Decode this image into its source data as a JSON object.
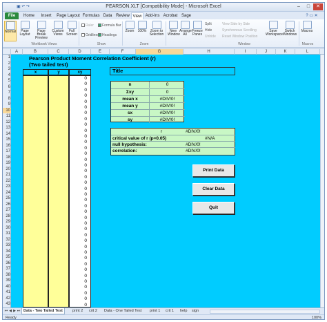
{
  "window": {
    "title": "PEARSON.XLT  [Compatibility Mode] - Microsoft Excel",
    "minimize": "–",
    "maximize": "□",
    "close": "✕"
  },
  "ribbon_tabs": [
    "File",
    "Home",
    "Insert",
    "Page Layout",
    "Formulas",
    "Data",
    "Review",
    "View",
    "Add-Ins",
    "Acrobat",
    "Sage"
  ],
  "ribbon": {
    "normal": "Normal",
    "page_layout": "Page Layout",
    "page_break_preview": "Page Break Preview",
    "custom_views": "Custom Views",
    "full_screen": "Full Screen",
    "ruler": "Ruler",
    "gridlines": "Gridlines",
    "formula_bar": "Formula Bar",
    "headings": "Headings",
    "zoom": "Zoom",
    "zoom_100": "100%",
    "zoom_to_selection": "Zoom to Selection",
    "new_window": "New Window",
    "arrange_all": "Arrange All",
    "freeze_panes": "Freeze Panes",
    "split": "Split",
    "hide": "Hide",
    "unhide": "Unhide",
    "view_side_by_side": "View Side by Side",
    "synchronous_scrolling": "Synchronous Scrolling",
    "reset_window_position": "Reset Window Position",
    "save_workspace": "Save Workspace",
    "switch_windows": "Switch Windows",
    "macros": "Macros",
    "group_workbook_views": "Workbook Views",
    "group_show": "Show",
    "group_zoom": "Zoom",
    "group_window": "Window",
    "group_macros": "Macros"
  },
  "columns": [
    "A",
    "B",
    "C",
    "D",
    "E",
    "F",
    "G",
    "H",
    "I",
    "J",
    "K",
    "L"
  ],
  "rows": [
    "1",
    "2",
    "3",
    "4",
    "5",
    "6",
    "7",
    "8",
    "9",
    "10",
    "11",
    "12",
    "13",
    "14",
    "15",
    "16",
    "17",
    "18",
    "19",
    "20",
    "21",
    "22",
    "23",
    "24",
    "25",
    "26",
    "27",
    "28",
    "29",
    "30",
    "31",
    "32",
    "33",
    "34",
    "35",
    "36",
    "37",
    "38",
    "39",
    "40",
    "41",
    "42",
    "43"
  ],
  "sheet": {
    "title_line1": "Pearson Product Moment Correlation Coefficient (r)",
    "title_line2": "(Two tailed test)",
    "col_x": "x",
    "col_y": "y",
    "col_xy": "xy",
    "xy_values": [
      "0",
      "0",
      "0",
      "0",
      "0",
      "0",
      "0",
      "0",
      "0",
      "0",
      "0",
      "0",
      "0",
      "0",
      "0",
      "0",
      "0",
      "0",
      "0",
      "0",
      "0",
      "0",
      "0",
      "0",
      "0",
      "0",
      "0",
      "0",
      "0",
      "0",
      "0",
      "0",
      "0",
      "0",
      "0",
      "0",
      "0",
      "0",
      "0",
      "0"
    ],
    "title_box": "Title",
    "stats": [
      {
        "label": "n",
        "value": "0"
      },
      {
        "label": "Σxy",
        "value": "0"
      },
      {
        "label": "mean x",
        "value": "#DIV/0!"
      },
      {
        "label": "mean y",
        "value": "#DIV/0!"
      },
      {
        "label": "sx",
        "value": "#DIV/0!"
      },
      {
        "label": "sy",
        "value": "#DIV/0!"
      }
    ],
    "r_label": "r",
    "r_value": "#DIV/0!",
    "critical_label": "critical value of r (p=0.05)",
    "critical_value": "#N/A",
    "null_label": "null hypothesis:",
    "null_value": "#DIV/0!",
    "corr_label": "correlation:",
    "corr_value": "#DIV/0!"
  },
  "buttons": {
    "print": "Print Data",
    "clear": "Clear Data",
    "quit": "Quit"
  },
  "sheet_tabs": [
    "Data - Two Tailed Test",
    "print 2",
    "crit 2",
    "Data - One Tailed Test",
    "print 1",
    "crit 1",
    "help",
    "sign"
  ],
  "status": {
    "ready": "Ready",
    "zoom": "100%"
  }
}
